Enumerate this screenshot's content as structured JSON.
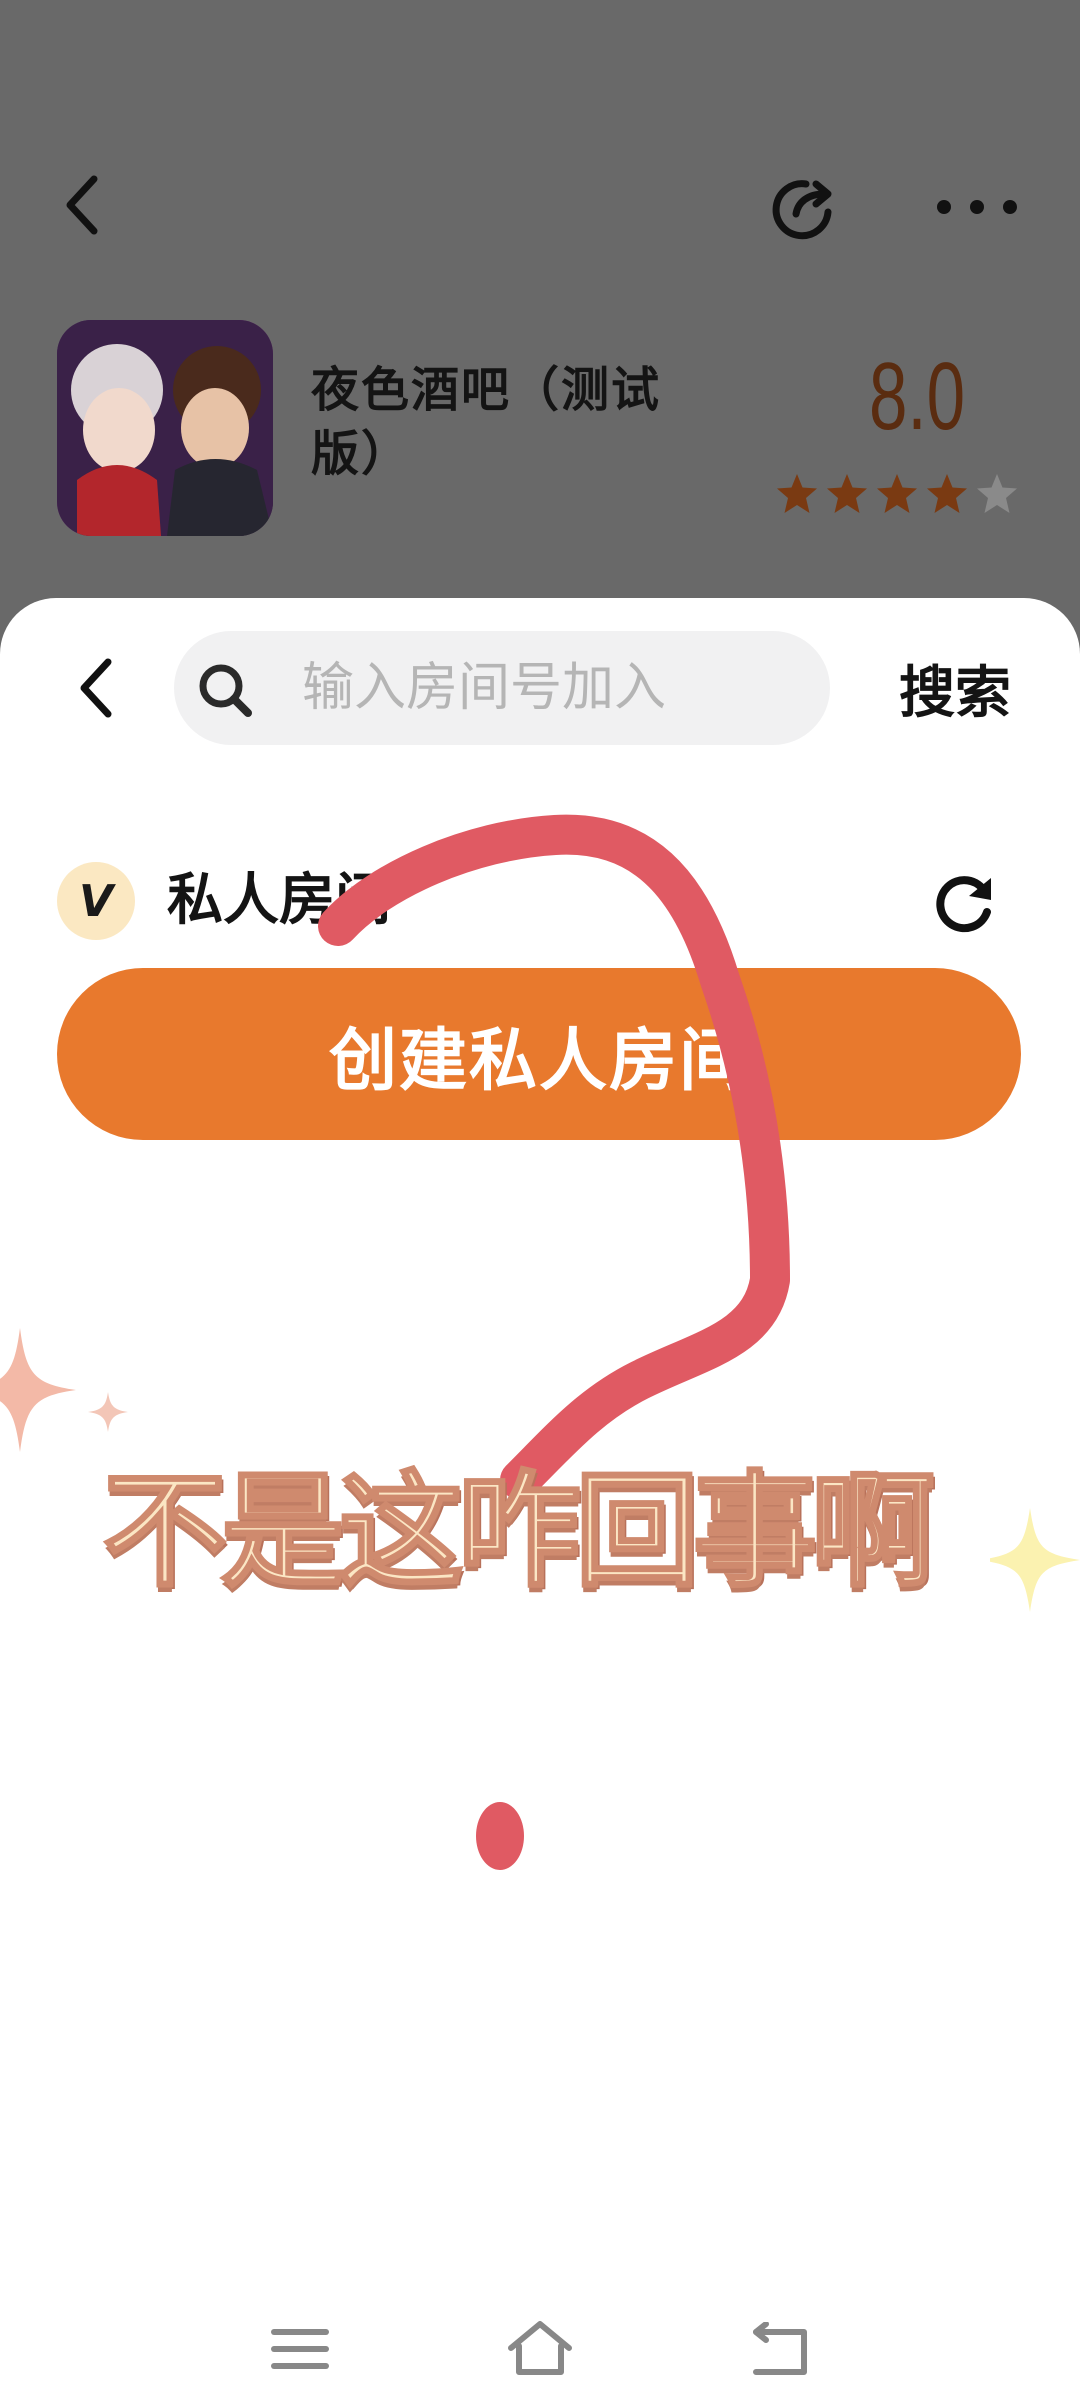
{
  "header": {
    "back_icon": "back-arrow-icon",
    "share_icon": "share-icon",
    "more_icon": "more-dots-icon"
  },
  "game": {
    "title": "夜色酒吧（测试版）",
    "score": "8.0",
    "rating_stars": 4,
    "star_color": "#7a3a12"
  },
  "sheet": {
    "search": {
      "placeholder": "输入房间号加入",
      "button_label": "搜索"
    },
    "section": {
      "badge_letter": "V",
      "title": "私人房间"
    },
    "create_button_label": "创建私人房间",
    "accent_color": "#e8792d"
  },
  "overlay": {
    "caption": "不是这咋回事啊",
    "drawn_mark": "question-mark",
    "mark_color": "#e05a63"
  },
  "nav": {
    "menu_icon": "menu-icon",
    "home_icon": "home-icon",
    "back_icon": "return-icon"
  }
}
